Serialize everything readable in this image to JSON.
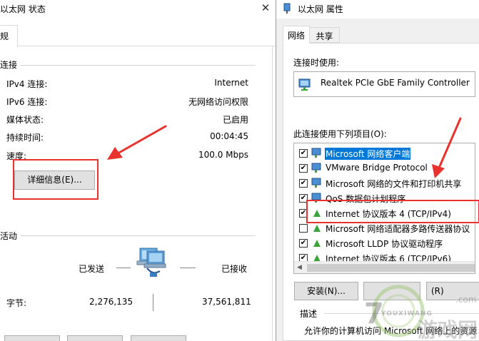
{
  "status_window": {
    "title": "以太网 状态",
    "close_glyph": "✕",
    "tab_general": "规",
    "connection_section": "连接",
    "rows": [
      {
        "label": "IPv4 连接:",
        "value": "Internet"
      },
      {
        "label": "IPv6 连接:",
        "value": "无网络访问权限"
      },
      {
        "label": "媒体状态:",
        "value": "已启用"
      },
      {
        "label": "持续时间:",
        "value": "00:04:45"
      },
      {
        "label": "速度:",
        "value": "100.0 Mbps"
      }
    ],
    "details_button": "详细信息(E)...",
    "activity_section": "活动",
    "sent_label": "已发送",
    "received_label": "已接收",
    "bytes_label": "字节:",
    "bytes_sent": "2,276,135",
    "bytes_received": "37,561,811"
  },
  "properties_window": {
    "title": "以太网 属性",
    "tabs": [
      "网络",
      "共享"
    ],
    "connect_using_label": "连接时使用:",
    "adapter_name": "Realtek PCIe GbE Family Controller",
    "items_label": "此连接使用下列项目(O):",
    "items": [
      {
        "label": "Microsoft 网络客户端",
        "checked": true,
        "icon": "network-client-icon",
        "selected": true
      },
      {
        "label": "VMware Bridge Protocol",
        "checked": true,
        "icon": "network-service-icon",
        "selected": false
      },
      {
        "label": "Microsoft 网络的文件和打印机共享",
        "checked": true,
        "icon": "network-service-icon",
        "selected": false
      },
      {
        "label": "QoS 数据包计划程序",
        "checked": true,
        "icon": "network-service-icon",
        "selected": false
      },
      {
        "label": "Internet 协议版本 4 (TCP/IPv4)",
        "checked": true,
        "icon": "protocol-icon",
        "selected": false
      },
      {
        "label": "Microsoft 网络适配器多路传送器协议",
        "checked": false,
        "icon": "protocol-icon",
        "selected": false
      },
      {
        "label": "Microsoft LLDP 协议驱动程序",
        "checked": true,
        "icon": "protocol-icon",
        "selected": false
      },
      {
        "label": "Internet 协议版本 6 (TCP/IPv6)",
        "checked": true,
        "icon": "protocol-icon",
        "selected": false
      }
    ],
    "install_button": "安装(N)...",
    "properties_button_partial": "(R)",
    "description_label": "描述",
    "description_text": "允许你的计算机访问 Microsoft 网络上的资源"
  },
  "watermark": {
    "site": "YOUXIWANG",
    "domain": ".com",
    "brand": "游戏网"
  },
  "colors": {
    "annotation_red": "#e8322b",
    "selection_blue": "#0078d7",
    "protocol_green": "#3aa33a"
  }
}
